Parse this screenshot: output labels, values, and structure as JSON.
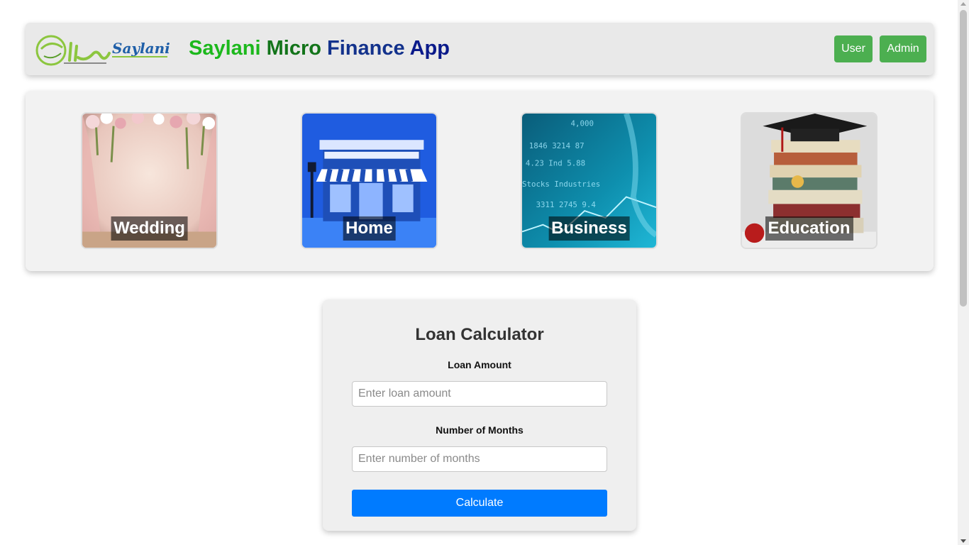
{
  "header": {
    "logo_text": "Saylani",
    "title_parts": [
      "Saylani",
      "Micro",
      "Finance",
      "App"
    ],
    "user_button": "User",
    "admin_button": "Admin"
  },
  "categories": [
    {
      "label": "Wedding"
    },
    {
      "label": "Home"
    },
    {
      "label": "Business"
    },
    {
      "label": "Education"
    }
  ],
  "calculator": {
    "title": "Loan Calculator",
    "amount_label": "Loan Amount",
    "amount_placeholder": "Enter loan amount",
    "amount_value": "",
    "months_label": "Number of Months",
    "months_placeholder": "Enter number of months",
    "months_value": "",
    "submit_label": "Calculate"
  },
  "colors": {
    "nav_button": "#4caf50",
    "calculate_button": "#007bff",
    "title_saylani": "#1cb81c",
    "title_micro": "#13741a",
    "title_finance": "#13328c",
    "title_app": "#0a1a8a"
  }
}
